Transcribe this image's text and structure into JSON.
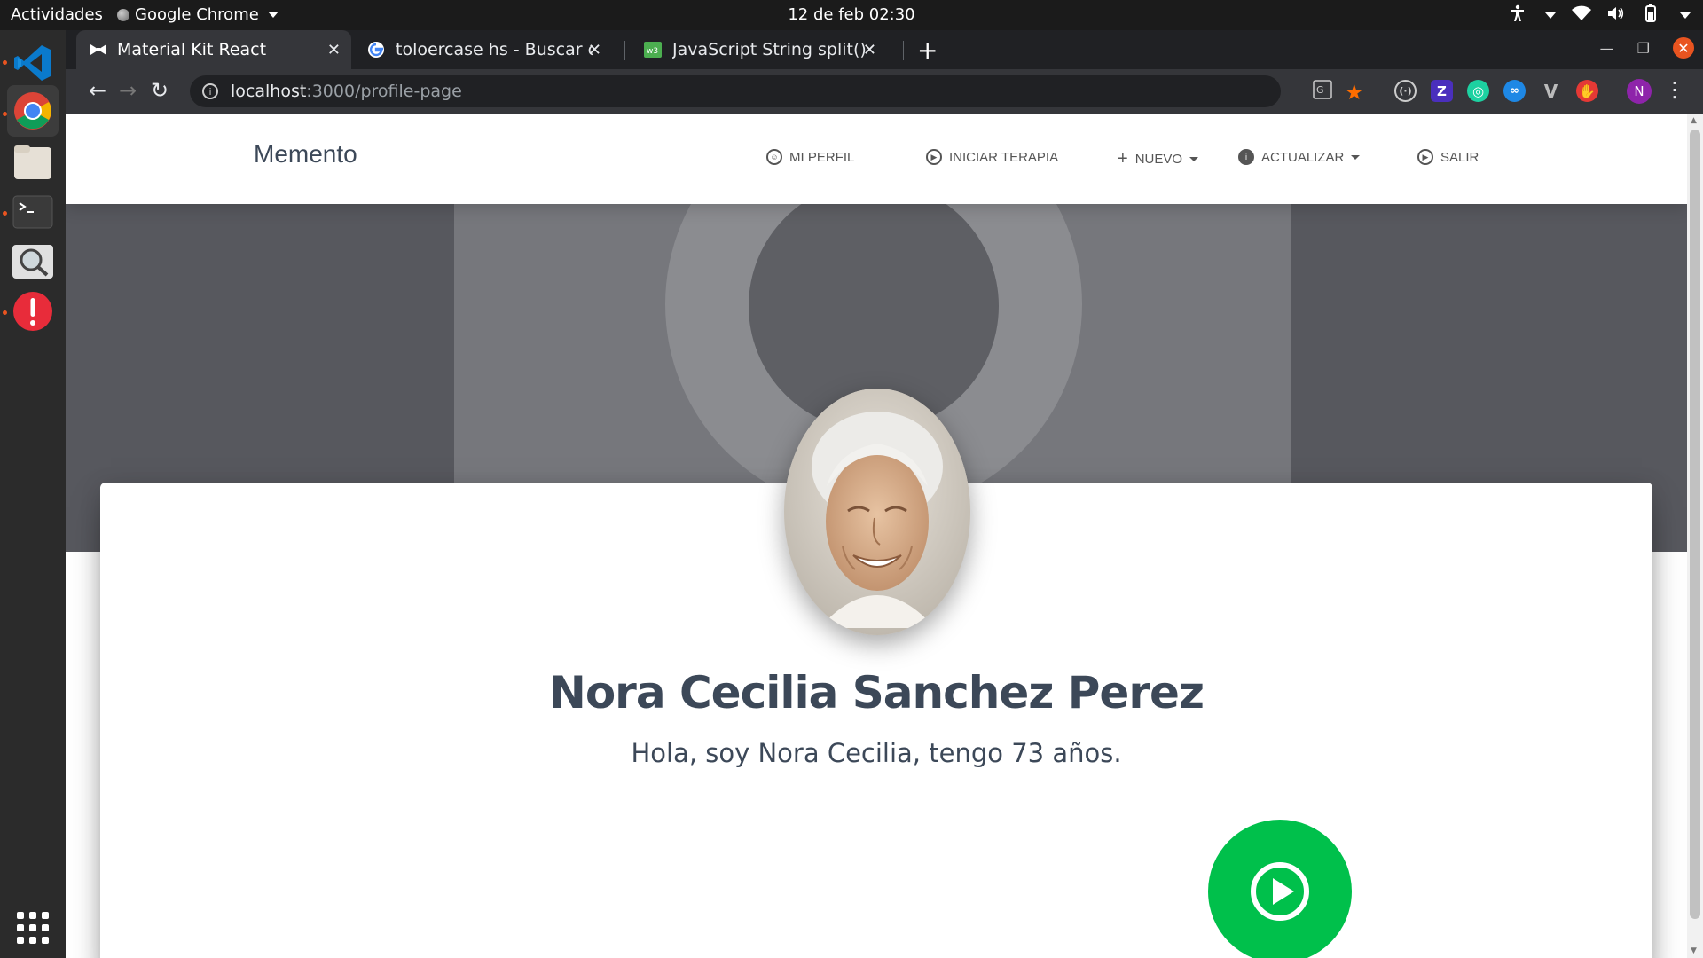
{
  "topbar": {
    "activities": "Actividades",
    "app_name": "Google Chrome",
    "clock": "12 de feb  02:30"
  },
  "dock": {
    "apps": [
      "vscode-icon",
      "chrome-icon",
      "files-icon",
      "terminal-icon",
      "image-viewer-icon",
      "updater-alert-icon"
    ]
  },
  "browser": {
    "tabs": [
      {
        "title": "Material Kit React",
        "icon": "bowtie-icon"
      },
      {
        "title": "toloercase hs - Buscar con Google",
        "icon": "google-icon"
      },
      {
        "title": "JavaScript String split() Method",
        "icon": "w3-icon"
      }
    ],
    "url_host": "localhost",
    "url_path": ":3000/profile-page",
    "profile_initial": "N"
  },
  "page": {
    "brand": "Memento",
    "nav": {
      "profile": "MI PERFIL",
      "therapy": "INICIAR TERAPIA",
      "new": "NUEVO",
      "update": "ACTUALIZAR",
      "logout": "SALIR"
    },
    "profile": {
      "name": "Nora Cecilia Sanchez Perez",
      "bio": "Hola, soy Nora Cecilia, tengo 73 años."
    },
    "colors": {
      "play_button": "#00c04b",
      "hero_bg": "#57585e",
      "text": "#3c4858"
    }
  }
}
